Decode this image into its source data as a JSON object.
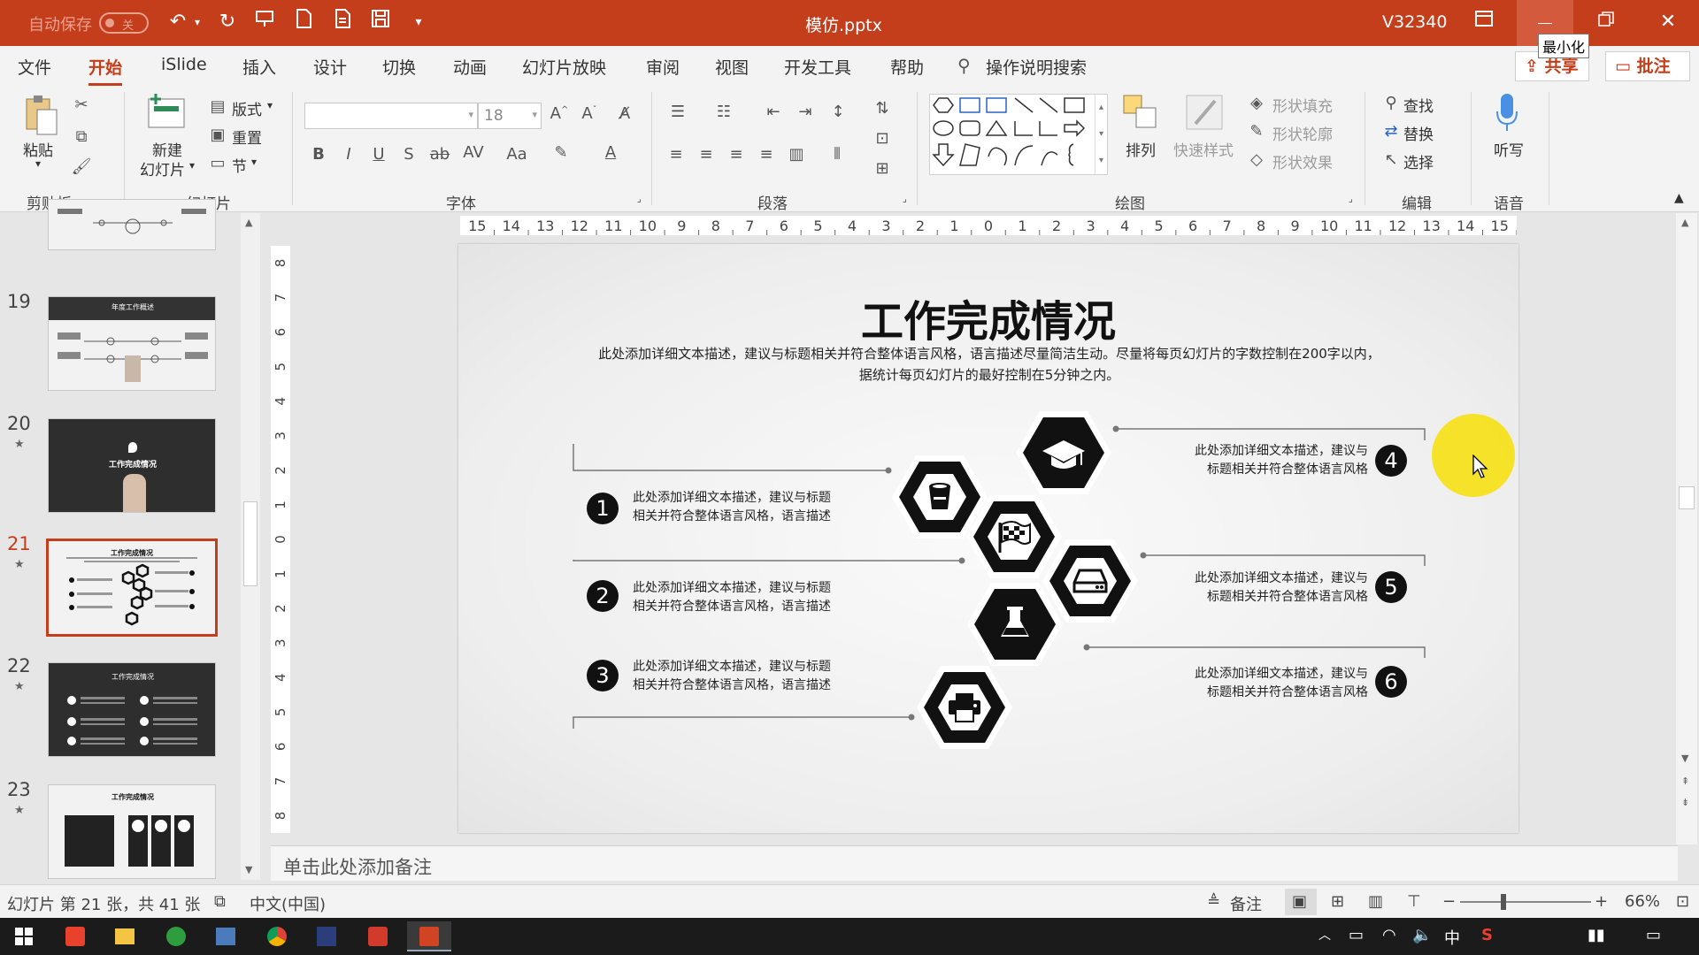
{
  "titlebar": {
    "autosave_label": "自动保存",
    "autosave_state": "关",
    "filename": "模仿.pptx",
    "user": "V32340",
    "minimize_tooltip": "最小化"
  },
  "tabs": [
    "文件",
    "开始",
    "iSlide",
    "插入",
    "设计",
    "切换",
    "动画",
    "幻灯片放映",
    "审阅",
    "视图",
    "开发工具",
    "帮助"
  ],
  "search_placeholder": "操作说明搜索",
  "share_label": "共享",
  "comment_label": "批注",
  "ribbon": {
    "clipboard": {
      "label": "剪贴板",
      "paste": "粘贴"
    },
    "slides": {
      "label": "幻灯片",
      "new_slide_1": "新建",
      "new_slide_2": "幻灯片",
      "layout": "版式",
      "reset": "重置",
      "section": "节"
    },
    "font": {
      "label": "字体",
      "size": "18"
    },
    "paragraph": {
      "label": "段落"
    },
    "drawing": {
      "label": "绘图",
      "arrange": "排列",
      "quick_styles": "快速样式",
      "shape_fill": "形状填充",
      "shape_outline": "形状轮廓",
      "shape_effects": "形状效果"
    },
    "editing": {
      "label": "编辑",
      "find": "查找",
      "replace": "替换",
      "select": "选择"
    },
    "voice": {
      "label": "语音",
      "dictate": "听写"
    }
  },
  "thumbnails": [
    {
      "num": "19",
      "title": "年度工作概述",
      "dark": false
    },
    {
      "num": "20",
      "title": "工作完成情况",
      "dark": true
    },
    {
      "num": "21",
      "title": "工作完成情况",
      "dark": false,
      "selected": true
    },
    {
      "num": "22",
      "title": "工作完成情况",
      "dark": true
    },
    {
      "num": "23",
      "title": "工作完成情况",
      "dark": false
    }
  ],
  "hruler_ticks": [
    "15",
    "14",
    "13",
    "12",
    "11",
    "10",
    "9",
    "8",
    "7",
    "6",
    "5",
    "4",
    "3",
    "2",
    "1",
    "0",
    "1",
    "2",
    "3",
    "4",
    "5",
    "6",
    "7",
    "8",
    "9",
    "10",
    "11",
    "12",
    "13",
    "14",
    "15"
  ],
  "vruler_ticks": [
    "8",
    "7",
    "6",
    "5",
    "4",
    "3",
    "2",
    "1",
    "0",
    "1",
    "2",
    "3",
    "4",
    "5",
    "6",
    "7",
    "8"
  ],
  "slide": {
    "title": "工作完成情况",
    "desc_line1": "此处添加详细文本描述，建议与标题相关并符合整体语言风格，语言描述尽量简洁生动。尽量将每页幻灯片的字数控制在200字以内，",
    "desc_line2": "据统计每页幻灯片的最好控制在5分钟之内。",
    "items": [
      {
        "num": "1",
        "line1": "此处添加详细文本描述，建议与标题",
        "line2": "相关并符合整体语言风格，语言描述"
      },
      {
        "num": "2",
        "line1": "此处添加详细文本描述，建议与标题",
        "line2": "相关并符合整体语言风格，语言描述"
      },
      {
        "num": "3",
        "line1": "此处添加详细文本描述，建议与标题",
        "line2": "相关并符合整体语言风格，语言描述"
      },
      {
        "num": "4",
        "line1": "此处添加详细文本描述，建议与",
        "line2": "标题相关并符合整体语言风格"
      },
      {
        "num": "5",
        "line1": "此处添加详细文本描述，建议与",
        "line2": "标题相关并符合整体语言风格"
      },
      {
        "num": "6",
        "line1": "此处添加详细文本描述，建议与",
        "line2": "标题相关并符合整体语言风格"
      }
    ]
  },
  "notes_placeholder": "单击此处添加备注",
  "status": {
    "slide_info": "幻灯片 第 21 张，共 41 张",
    "language": "中文(中国)",
    "notes": "备注",
    "zoom": "66%",
    "zoom_fraction": 0.66
  },
  "taskbar": {
    "ime": "中"
  }
}
